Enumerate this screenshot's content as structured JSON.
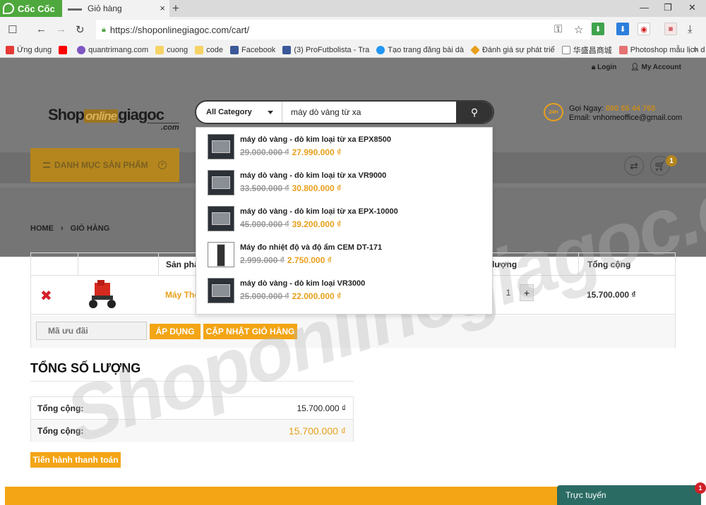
{
  "browser": {
    "logo": "Cốc Cốc",
    "tab_title": "Giỏ hàng",
    "tab_close": "×",
    "new_tab": "+",
    "url": "https://shoponlinegiagoc.com/cart/",
    "bookmarks": [
      {
        "label": "Ứng dụng",
        "color": "#e53935"
      },
      {
        "label": "",
        "color": "#ff0000"
      },
      {
        "label": "quantrimang.com",
        "color": "#7e57c2"
      },
      {
        "label": "cuong",
        "color": "#f6d365"
      },
      {
        "label": "code",
        "color": "#f6d365"
      },
      {
        "label": "Facebook",
        "color": "#3b5998"
      },
      {
        "label": "(3) ProFutbolista - Tra",
        "color": "#3b5998"
      },
      {
        "label": "Tạo trang đăng bài dà",
        "color": "#2196f3"
      },
      {
        "label": "Đánh giá sự phát triể",
        "color": "#e8a01c"
      },
      {
        "label": "华盛昌商城",
        "color": "#ffffff"
      },
      {
        "label": "Photoshop mẫu lịch d",
        "color": "#e57373"
      }
    ]
  },
  "header": {
    "login": "Login",
    "account": "My Account",
    "logo": {
      "shop": "Shop",
      "online": "online",
      "giagoc": "giagoc",
      "com": ".com"
    },
    "search": {
      "category": "All Category",
      "query": "máy dò vàng từ xa"
    },
    "hotline_label": "Gọi Ngay:",
    "hotline_phone": "090 55 44 765",
    "email_label": "Email:",
    "email": "vnhomeoffice@gmail.com",
    "hotline_icon_text": "24H",
    "menu_label": "DANH MỤC SẢN PHẨM",
    "cart_count": "1"
  },
  "breadcrumb": {
    "home": "HOME",
    "current": "GIỎ HÀNG"
  },
  "cart": {
    "headers": {
      "product": "Sản phẩ",
      "quantity": "lượng",
      "total": "Tổng cộng"
    },
    "item": {
      "name": "Máy Thô",
      "quantity": "1",
      "total": "15.700.000 ₫"
    },
    "coupon_placeholder": "Mã ưu đãi",
    "apply_label": "ÁP DỤNG",
    "update_label": "CẬP NHẬT GIỎ HÀNG"
  },
  "totals": {
    "title": "TỔNG SỐ LƯỢNG",
    "subtotal_label": "Tổng cộng:",
    "subtotal_value": "15.700.000 ₫",
    "total_label": "Tổng cộng:",
    "total_value": "15.700.000 ₫",
    "checkout_label": "Tiến hành thanh toán"
  },
  "suggestions": [
    {
      "name": "máy dò vàng - dò kim loại từ xa EPX8500",
      "old_price": "29.000.000 ₫",
      "new_price": "27.990.000 ₫"
    },
    {
      "name": "máy dò vàng - dò kim loại từ xa VR9000",
      "old_price": "33.500.000 ₫",
      "new_price": "30.800.000 ₫"
    },
    {
      "name": "máy dò vàng - dò kim loại từ xa EPX-10000",
      "old_price": "45.000.000 ₫",
      "new_price": "39.200.000 ₫"
    },
    {
      "name": "Máy đo nhiệt độ và độ ẩm CEM DT-171",
      "old_price": "2.999.000 ₫",
      "new_price": "2.750.000 ₫"
    },
    {
      "name": "máy dò vàng - dò kim loại VR3000",
      "old_price": "25.000.000 ₫",
      "new_price": "22.000.000 ₫"
    }
  ],
  "chat": {
    "label": "Trực tuyến",
    "badge": "1"
  },
  "watermark": "Shoponlinegiagoc.com",
  "colors": {
    "accent": "#f3a515",
    "price": "#e8a01c",
    "remove": "#d4202a",
    "chat": "#2a6b64"
  }
}
